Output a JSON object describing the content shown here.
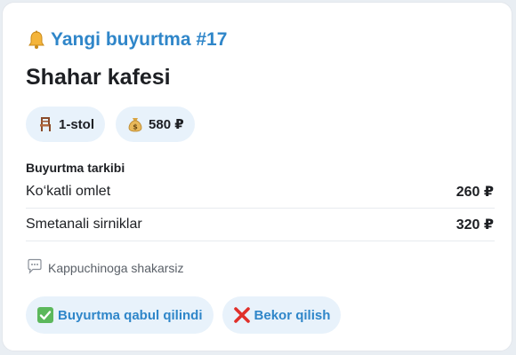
{
  "header": {
    "icon": "bell-icon",
    "title": "Yangi buyurtma #17"
  },
  "cafe": {
    "name": "Shahar kafesi"
  },
  "chips": {
    "table": {
      "icon": "chair-icon",
      "label": "1-stol"
    },
    "total": {
      "icon": "money-bag-icon",
      "label": "580 ₽"
    }
  },
  "order": {
    "section_title": "Buyurtma tarkibi",
    "items": [
      {
        "name": "Ko‘katli omlet",
        "price": "260 ₽"
      },
      {
        "name": "Smetanali sirniklar",
        "price": "320 ₽"
      }
    ]
  },
  "note": {
    "icon": "speech-bubble-icon",
    "text": "Kappuchinoga shakarsiz"
  },
  "actions": {
    "accept": {
      "icon": "check-mark-icon",
      "label": "Buyurtma qabul qilindi"
    },
    "cancel": {
      "icon": "cross-mark-icon",
      "label": "Bekor qilish"
    }
  },
  "colors": {
    "accent": "#2f86c9",
    "chip_bg": "#e8f2fb",
    "check_green": "#5cb85c",
    "cross_red": "#e0302a"
  }
}
